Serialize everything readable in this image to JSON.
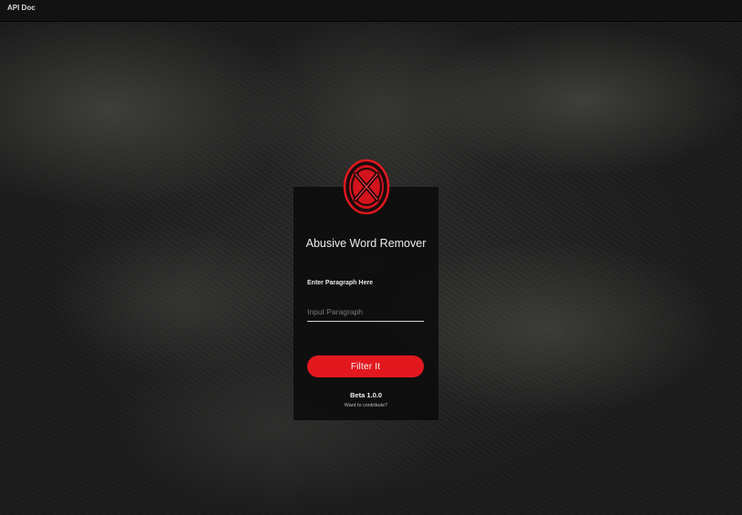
{
  "topbar": {
    "brand": "API Doc"
  },
  "card": {
    "logo_icon": "x-shield-icon",
    "title": "Abusive Word Remover",
    "field_label": "Enter Paragraph Here",
    "input_placeholder": "Input Paragraph",
    "input_value": "",
    "filter_button": "Filter  It",
    "version": "Beta 1.0.0",
    "contribute_link": "Want to contribute?"
  },
  "colors": {
    "accent": "#e3181f",
    "topbar": "#121212",
    "card_bg": "#0a0a0a"
  }
}
